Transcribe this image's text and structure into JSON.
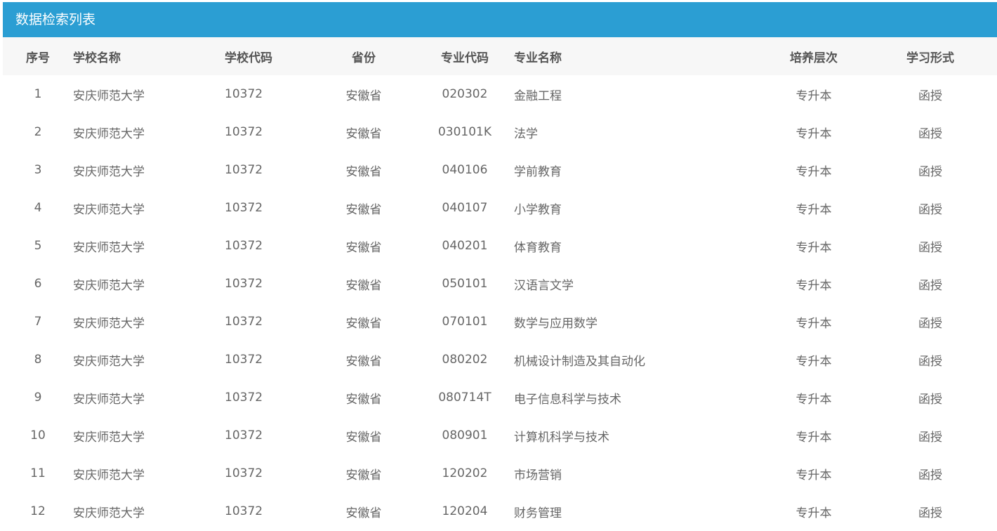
{
  "panel": {
    "title": "数据检索列表"
  },
  "table": {
    "headers": {
      "index": "序号",
      "school_name": "学校名称",
      "school_code": "学校代码",
      "province": "省份",
      "major_code": "专业代码",
      "major_name": "专业名称",
      "level": "培养层次",
      "study_form": "学习形式"
    },
    "rows": [
      {
        "index": "1",
        "school_name": "安庆师范大学",
        "school_code": "10372",
        "province": "安徽省",
        "major_code": "020302",
        "major_name": "金融工程",
        "level": "专升本",
        "study_form": "函授"
      },
      {
        "index": "2",
        "school_name": "安庆师范大学",
        "school_code": "10372",
        "province": "安徽省",
        "major_code": "030101K",
        "major_name": "法学",
        "level": "专升本",
        "study_form": "函授"
      },
      {
        "index": "3",
        "school_name": "安庆师范大学",
        "school_code": "10372",
        "province": "安徽省",
        "major_code": "040106",
        "major_name": "学前教育",
        "level": "专升本",
        "study_form": "函授"
      },
      {
        "index": "4",
        "school_name": "安庆师范大学",
        "school_code": "10372",
        "province": "安徽省",
        "major_code": "040107",
        "major_name": "小学教育",
        "level": "专升本",
        "study_form": "函授"
      },
      {
        "index": "5",
        "school_name": "安庆师范大学",
        "school_code": "10372",
        "province": "安徽省",
        "major_code": "040201",
        "major_name": "体育教育",
        "level": "专升本",
        "study_form": "函授"
      },
      {
        "index": "6",
        "school_name": "安庆师范大学",
        "school_code": "10372",
        "province": "安徽省",
        "major_code": "050101",
        "major_name": "汉语言文学",
        "level": "专升本",
        "study_form": "函授"
      },
      {
        "index": "7",
        "school_name": "安庆师范大学",
        "school_code": "10372",
        "province": "安徽省",
        "major_code": "070101",
        "major_name": "数学与应用数学",
        "level": "专升本",
        "study_form": "函授"
      },
      {
        "index": "8",
        "school_name": "安庆师范大学",
        "school_code": "10372",
        "province": "安徽省",
        "major_code": "080202",
        "major_name": "机械设计制造及其自动化",
        "level": "专升本",
        "study_form": "函授"
      },
      {
        "index": "9",
        "school_name": "安庆师范大学",
        "school_code": "10372",
        "province": "安徽省",
        "major_code": "080714T",
        "major_name": "电子信息科学与技术",
        "level": "专升本",
        "study_form": "函授"
      },
      {
        "index": "10",
        "school_name": "安庆师范大学",
        "school_code": "10372",
        "province": "安徽省",
        "major_code": "080901",
        "major_name": "计算机科学与技术",
        "level": "专升本",
        "study_form": "函授"
      },
      {
        "index": "11",
        "school_name": "安庆师范大学",
        "school_code": "10372",
        "province": "安徽省",
        "major_code": "120202",
        "major_name": "市场营销",
        "level": "专升本",
        "study_form": "函授"
      },
      {
        "index": "12",
        "school_name": "安庆师范大学",
        "school_code": "10372",
        "province": "安徽省",
        "major_code": "120204",
        "major_name": "财务管理",
        "level": "专升本",
        "study_form": "函授"
      }
    ]
  }
}
